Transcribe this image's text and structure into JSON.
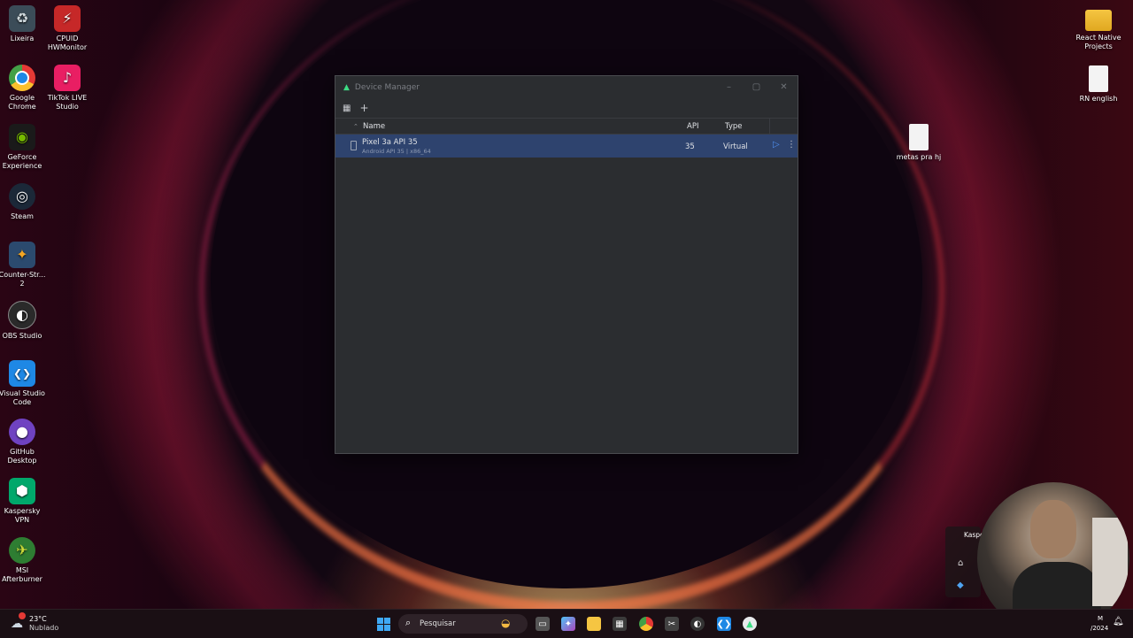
{
  "desktop": {
    "left_icons": [
      {
        "label": "Lixeira",
        "icon": "recycle-bin-icon",
        "glyph": "♻",
        "color": "#cfd8dc"
      },
      {
        "label": "CPUID HWMonitor",
        "icon": "hwmonitor-icon",
        "glyph": "⚡",
        "color": "#c62828"
      },
      {
        "label": "Google Chrome",
        "icon": "chrome-icon",
        "glyph": "●",
        "color": "#e53935"
      },
      {
        "label": "TikTok LIVE Studio",
        "icon": "tiktok-live-icon",
        "glyph": "♪",
        "color": "#e91e63"
      },
      {
        "label": "GeForce Experience",
        "icon": "geforce-icon",
        "glyph": "◉",
        "color": "#76b900"
      },
      {
        "label": "Steam",
        "icon": "steam-icon",
        "glyph": "◎",
        "color": "#1b2838"
      },
      {
        "label": "Counter-Str... 2",
        "icon": "counter-strike-icon",
        "glyph": "✦",
        "color": "#f4a623"
      },
      {
        "label": "OBS Studio",
        "icon": "obs-icon",
        "glyph": "◐",
        "color": "#3b3b3b"
      },
      {
        "label": "Visual Studio Code",
        "icon": "vscode-icon",
        "glyph": "❮❯",
        "color": "#1e88e5"
      },
      {
        "label": "GitHub Desktop",
        "icon": "github-desktop-icon",
        "glyph": "●",
        "color": "#6f42c1"
      },
      {
        "label": "Kaspersky VPN",
        "icon": "kaspersky-vpn-icon",
        "glyph": "⬢",
        "color": "#00a86b"
      },
      {
        "label": "MSI Afterburner",
        "icon": "msi-afterburner-icon",
        "glyph": "✈",
        "color": "#8bc34a"
      }
    ],
    "right_icons": [
      {
        "label": "React Native Projects",
        "icon": "folder-icon"
      },
      {
        "label": "RN english",
        "icon": "text-file-icon"
      },
      {
        "label": "metas pra hj",
        "icon": "text-file-icon"
      }
    ]
  },
  "window": {
    "title": "Device Manager",
    "toolbar": {
      "add_label": "+"
    },
    "columns": {
      "name": "Name",
      "api": "API",
      "type": "Type"
    },
    "devices": [
      {
        "name": "Pixel 3a API 35",
        "subtitle": "Android API 35 | x86_64",
        "api": "35",
        "type": "Virtual"
      }
    ]
  },
  "tray": {
    "kaspersky_label": "Kaspe",
    "date_partial": "/2024",
    "time_partial": "M"
  },
  "taskbar": {
    "weather_temp": "23°C",
    "weather_desc": "Nublado",
    "search_placeholder": "Pesquisar"
  },
  "colors": {
    "window_bg": "#2b2d30",
    "selected_row": "#2e436e",
    "accent_play": "#4f8ff0"
  }
}
